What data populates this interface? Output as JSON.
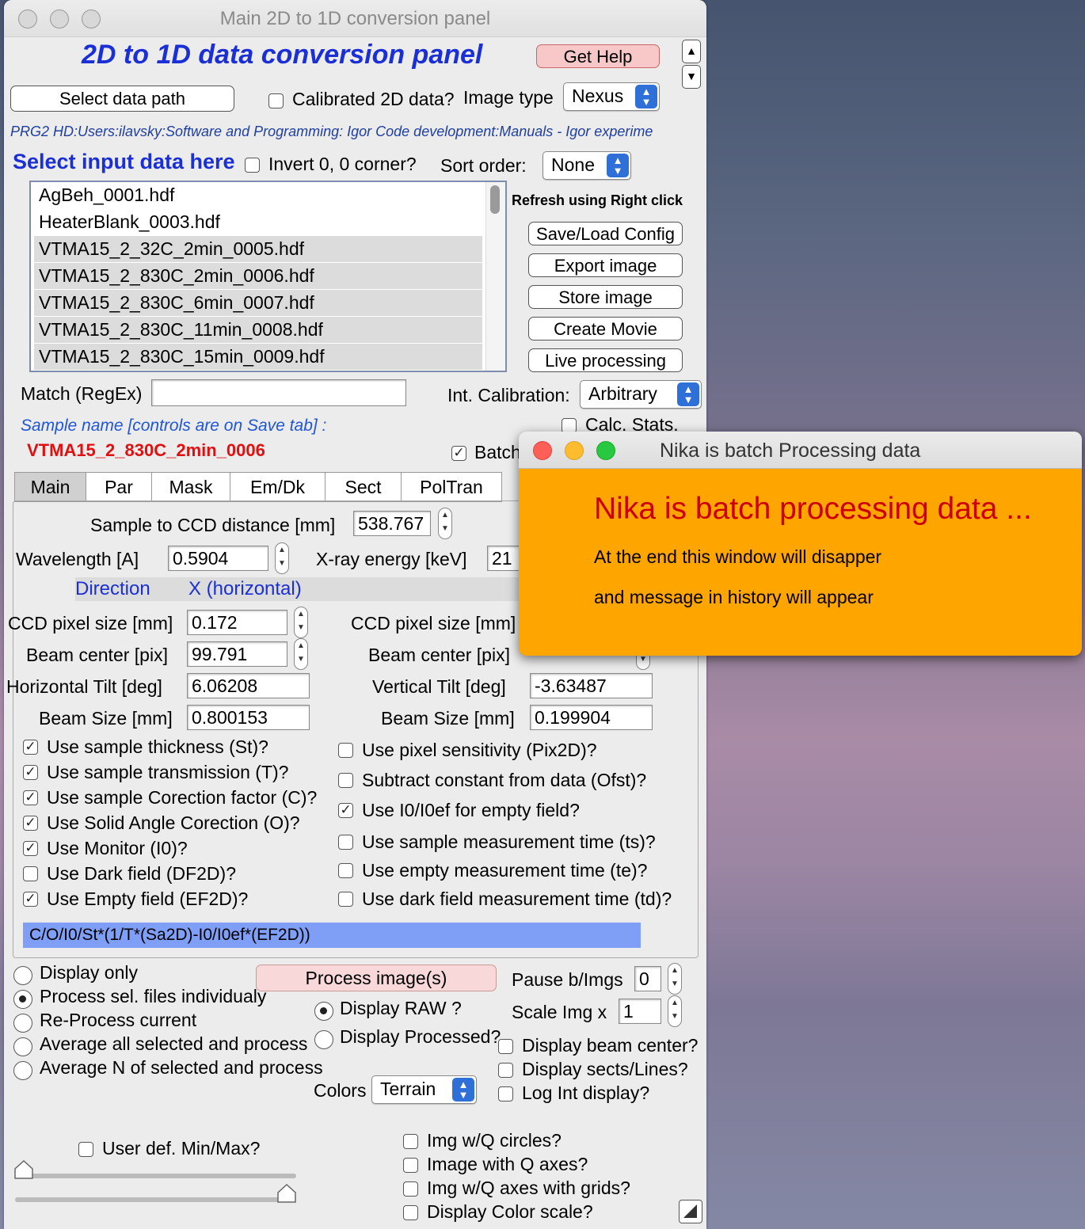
{
  "window": {
    "title": "Main 2D to 1D conversion panel"
  },
  "header": {
    "heading": "2D to 1D data conversion panel",
    "get_help": "Get Help"
  },
  "data_path": {
    "select_button": "Select data path",
    "calibrated_label": "Calibrated 2D data?",
    "image_type_label": "Image type",
    "image_type_value": "Nexus",
    "path_text": "PRG2 HD:Users:ilavsky:Software and Programming: Igor Code development:Manuals - Igor experime"
  },
  "input": {
    "heading": "Select input data here",
    "invert_label": "Invert 0, 0 corner?",
    "sort_label": "Sort order:",
    "sort_value": "None",
    "refresh_hint": "Refresh using Right click",
    "files": [
      "AgBeh_0001.hdf",
      "HeaterBlank_0003.hdf",
      "VTMA15_2_32C_2min_0005.hdf",
      "VTMA15_2_830C_2min_0006.hdf",
      "VTMA15_2_830C_6min_0007.hdf",
      "VTMA15_2_830C_11min_0008.hdf",
      "VTMA15_2_830C_15min_0009.hdf"
    ],
    "match_label": "Match (RegEx)",
    "match_value": ""
  },
  "side_buttons": {
    "save_load": "Save/Load Config",
    "export_image": "Export image",
    "store_image": "Store image",
    "create_movie": "Create Movie",
    "live_processing": "Live processing"
  },
  "calibration": {
    "label": "Int. Calibration:",
    "value": "Arbitrary",
    "calc_stats": "Calc. Stats.",
    "batch": "Batch"
  },
  "sample": {
    "label": "Sample name [controls are on Save tab] :",
    "name": "VTMA15_2_830C_2min_0006"
  },
  "tabs": [
    "Main",
    "Par",
    "Mask",
    "Em/Dk",
    "Sect",
    "PolTran"
  ],
  "geometry": {
    "distance_label": "Sample to CCD distance [mm]",
    "distance_value": "538.767",
    "wavelength_label": "Wavelength [A]",
    "wavelength_value": "0.5904",
    "energy_label": "X-ray energy [keV]",
    "energy_value": "21",
    "direction_label": "Direction",
    "x_label": "X (horizontal)",
    "pixel_label": "CCD pixel size [mm]",
    "pixel_x": "0.172",
    "beam_center_label": "Beam center [pix]",
    "beam_center_x": "99.791",
    "htilt_label": "Horizontal Tilt [deg]",
    "htilt_value": "6.06208",
    "vtilt_label": "Vertical Tilt [deg]",
    "vtilt_value": "-3.63487",
    "beam_size_label": "Beam Size [mm]",
    "beam_size_x": "0.800153",
    "beam_size_y": "0.199904"
  },
  "corrections_left": [
    {
      "label": "Use sample thickness (St)?",
      "checked": true
    },
    {
      "label": "Use sample transmission (T)?",
      "checked": true
    },
    {
      "label": "Use sample Corection factor (C)?",
      "checked": true
    },
    {
      "label": "Use Solid Angle Corection (O)?",
      "checked": true
    },
    {
      "label": "Use Monitor (I0)?",
      "checked": true
    },
    {
      "label": "Use Dark field (DF2D)?",
      "checked": false
    },
    {
      "label": "Use Empty field (EF2D)?",
      "checked": true
    }
  ],
  "corrections_right": [
    {
      "label": "Use pixel sensitivity (Pix2D)?",
      "checked": false
    },
    {
      "label": "Subtract constant from data (Ofst)?",
      "checked": false
    },
    {
      "label": "Use I0/I0ef for empty field?",
      "checked": true
    },
    {
      "label": "Use sample measurement time (ts)?",
      "checked": false
    },
    {
      "label": "Use empty measurement time (te)?",
      "checked": false
    },
    {
      "label": "Use dark field measurement time (td)?",
      "checked": false
    }
  ],
  "formula": "C/O/I0/St*(1/T*(Sa2D)-I0/I0ef*(EF2D))",
  "processing": {
    "modes": [
      {
        "label": "Display only",
        "on": false
      },
      {
        "label": "Process sel. files individualy",
        "on": true
      },
      {
        "label": "Re-Process current",
        "on": false
      },
      {
        "label": "Average all selected and process",
        "on": false
      },
      {
        "label": "Average N of selected and process",
        "on": false
      }
    ],
    "process_button": "Process image(s)",
    "display_raw": "Display RAW ?",
    "display_processed": "Display Processed?",
    "pause_label": "Pause b/Imgs",
    "pause_value": "0",
    "scale_label": "Scale Img x",
    "scale_value": "1",
    "display_beam_center": "Display beam center?",
    "display_sects": "Display sects/Lines?",
    "log_int": "Log Int display?",
    "colors_label": "Colors",
    "colors_value": "Terrain",
    "user_minmax": "User def. Min/Max?",
    "q_circles": "Img w/Q circles?",
    "q_axes": "Image with Q axes?",
    "q_grids": "Img w/Q axes with grids?",
    "color_scale": "Display Color scale?",
    "slider_min_fraction": 0.0,
    "slider_max_fraction": 1.0
  },
  "dialog": {
    "title": "Nika is batch Processing data",
    "headline": "Nika is batch processing data ...",
    "line1": "At the end this window will disapper",
    "line2": "and message in history will appear",
    "bg_color": "#ffa500",
    "headline_color": "#cc0000"
  }
}
